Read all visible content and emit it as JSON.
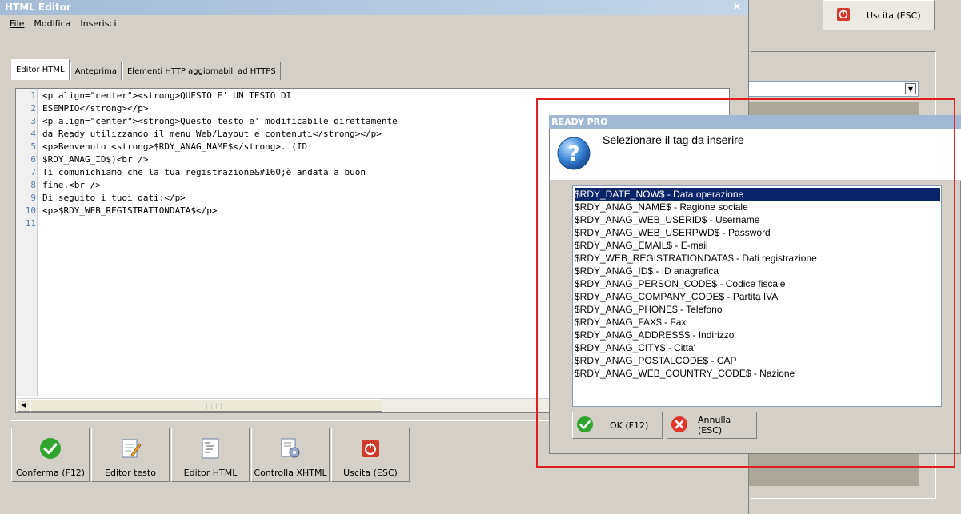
{
  "background_window": {
    "exit_label": "Uscita (ESC)"
  },
  "editor": {
    "title": "HTML Editor",
    "close_glyph": "×",
    "menu": [
      "File",
      "Modifica",
      "Inserisci"
    ],
    "tabs": [
      "Editor HTML",
      "Anteprima",
      "Elementi HTTP aggiornabili ad HTTPS"
    ],
    "code_lines": [
      {
        "n": "1",
        "text": "<p align=\"center\"><strong>QUESTO E' UN TESTO DI"
      },
      {
        "n": "2",
        "text": "ESEMPIO</strong></p>"
      },
      {
        "n": "3",
        "text": "<p align=\"center\"><strong>Questo testo e' modificabile direttamente"
      },
      {
        "n": "4",
        "text": "da Ready utilizzando il menu Web/Layout e contenuti</strong></p>"
      },
      {
        "n": "5",
        "text": "<p>Benvenuto <strong>$RDY_ANAG_NAME$</strong>. (ID:"
      },
      {
        "n": "6",
        "text": "$RDY_ANAG_ID$)<br />"
      },
      {
        "n": "7",
        "text": "Ti comunichiamo che la tua registrazione&#160;è andata a buon"
      },
      {
        "n": "8",
        "text": "fine.<br />"
      },
      {
        "n": "9",
        "text": "Di seguito i tuoi dati:</p>"
      },
      {
        "n": "10",
        "text": "<p>$RDY_WEB_REGISTRATIONDATA$</p>"
      },
      {
        "n": "11",
        "text": ""
      }
    ],
    "toolbar": [
      {
        "label": "Conferma (F12)",
        "icon": "check-icon"
      },
      {
        "label": "Editor testo",
        "icon": "text-editor-icon"
      },
      {
        "label": "Editor HTML",
        "icon": "html-editor-icon"
      },
      {
        "label": "Controlla XHTML",
        "icon": "gear-check-icon"
      },
      {
        "label": "Uscita (ESC)",
        "icon": "exit-icon"
      }
    ]
  },
  "dialog": {
    "title": "READY PRO",
    "prompt": "Selezionare il tag da inserire",
    "items": [
      "$RDY_DATE_NOW$ - Data operazione",
      "$RDY_ANAG_NAME$ - Ragione sociale",
      "$RDY_ANAG_WEB_USERID$ - Username",
      "$RDY_ANAG_WEB_USERPWD$ - Password",
      "$RDY_ANAG_EMAIL$ - E-mail",
      "$RDY_WEB_REGISTRATIONDATA$ - Dati registrazione",
      "$RDY_ANAG_ID$ - ID anagrafica",
      "$RDY_ANAG_PERSON_CODE$ - Codice fiscale",
      "$RDY_ANAG_COMPANY_CODE$ - Partita IVA",
      "$RDY_ANAG_PHONE$ - Telefono",
      "$RDY_ANAG_FAX$ - Fax",
      "$RDY_ANAG_ADDRESS$ - Indirizzo",
      "$RDY_ANAG_CITY$ - Citta'",
      "$RDY_ANAG_POSTALCODE$ - CAP",
      "$RDY_ANAG_WEB_COUNTRY_CODE$ - Nazione"
    ],
    "selected_index": 0,
    "ok_label": "OK (F12)",
    "cancel_label": "Annulla (ESC)"
  },
  "colors": {
    "highlight": "#e02020",
    "selection": "#0a246a"
  }
}
